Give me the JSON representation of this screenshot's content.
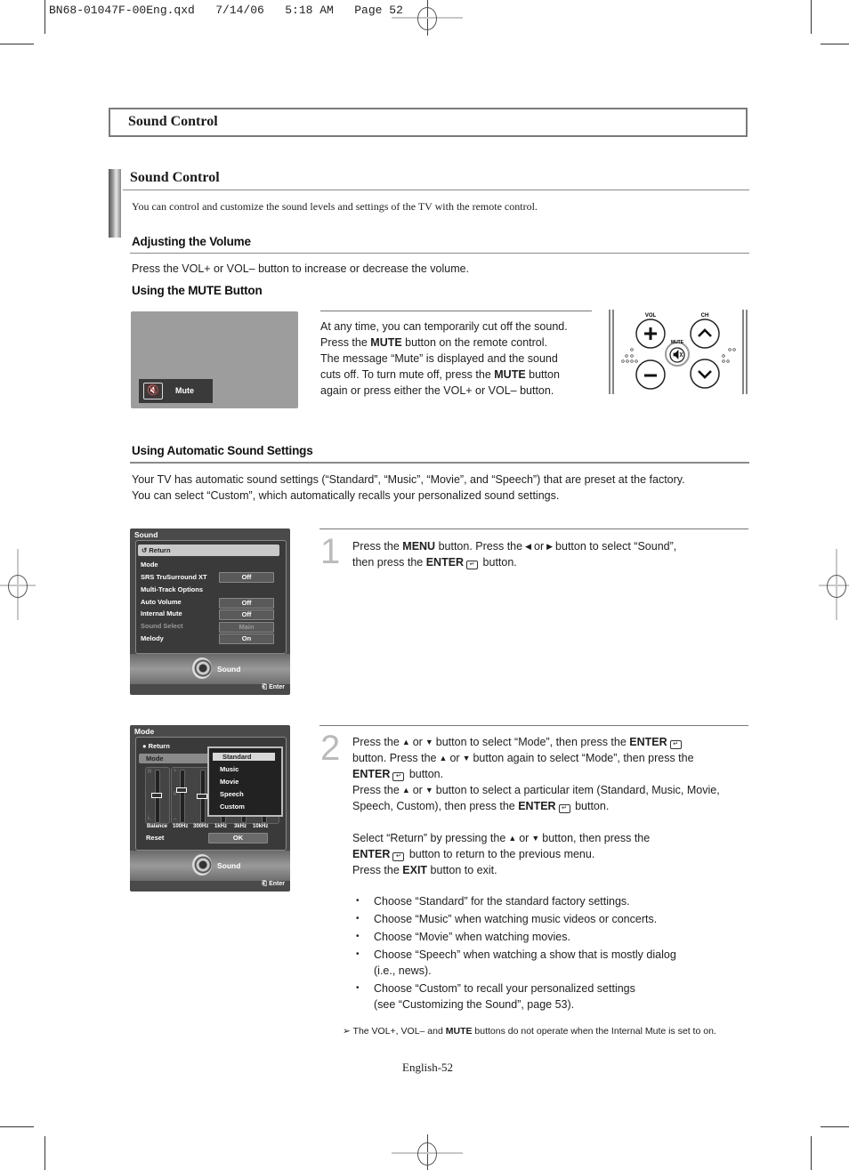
{
  "slug": "BN68-01047F-00Eng.qxd   7/14/06   5:18 AM   Page 52",
  "header_box": {
    "title": "Sound Control"
  },
  "section": {
    "title": "Sound Control",
    "intro": "You can control and customize the sound levels and settings of the TV with the remote control."
  },
  "volume": {
    "heading": "Adjusting the Volume",
    "text": "Press the VOL+ or VOL– button to increase or decrease the volume."
  },
  "mute": {
    "heading": "Using the MUTE Button",
    "screen_label": "Mute",
    "lines": [
      {
        "pre": "At any time, you can temporarily cut off the sound.",
        "bold": "",
        "post": ""
      },
      {
        "pre": "Press the ",
        "bold": "MUTE",
        "post": " button on the remote control."
      },
      {
        "pre": "The message “Mute” is displayed and the sound",
        "bold": "",
        "post": ""
      },
      {
        "pre": "cuts off. To turn mute off, press the ",
        "bold": "MUTE",
        "post": " button"
      },
      {
        "pre": "again or press either the VOL+ or VOL– button.",
        "bold": "",
        "post": ""
      }
    ],
    "remote": {
      "vol_label": "VOL",
      "ch_label": "CH",
      "mute_label": "MUTE"
    }
  },
  "auto": {
    "heading": "Using Automatic Sound Settings",
    "line1": "Your TV has automatic sound settings (“Standard”, “Music”, “Movie”, and “Speech”) that are preset at the factory.",
    "line2": "You can select “Custom”, which automatically recalls your personalized sound settings."
  },
  "menu1": {
    "title": "Sound",
    "return_label": "Return",
    "items": [
      {
        "label": "Mode",
        "value": null,
        "dim": false
      },
      {
        "label": "SRS TruSurround XT",
        "value": "Off",
        "dim": false
      },
      {
        "label": "Multi-Track Options",
        "value": null,
        "dim": false
      },
      {
        "label": "Auto Volume",
        "value": "Off",
        "dim": false
      },
      {
        "label": "Internal Mute",
        "value": "Off",
        "dim": false
      },
      {
        "label": "Sound Select",
        "value": "Main",
        "dim": true
      },
      {
        "label": "Melody",
        "value": "On",
        "dim": false
      }
    ],
    "footer_label": "Sound",
    "enter_label": "Enter"
  },
  "menu2": {
    "title": "Mode",
    "return_label": "Return",
    "mode_label": "Mode",
    "dropdown": [
      "Standard",
      "Music",
      "Movie",
      "Speech",
      "Custom"
    ],
    "dropdown_selected": "Standard",
    "eq_labels": [
      "Balance",
      "100Hz",
      "300Hz",
      "1kHz",
      "3kHz",
      "10kHz"
    ],
    "balance_marks": {
      "top": "R",
      "bottom": "L"
    },
    "eq_marks": {
      "top": "+",
      "mid": "0",
      "bottom": "–"
    },
    "reset_label": "Reset",
    "ok_label": "OK",
    "footer_label": "Sound",
    "enter_label": "Enter"
  },
  "step1": {
    "number": "1",
    "l1_a": "Press the ",
    "l1_b": "MENU",
    "l1_c": " button. Press the",
    "l1_or": "or",
    "l1_d": "button to select “Sound”,",
    "l2_a": "then press the ",
    "l2_b": "ENTER",
    "l2_c": " button."
  },
  "step2": {
    "number": "2",
    "p1_a": "Press the",
    "p1_or": "or",
    "p1_b": "button to select “Mode”, then press the ",
    "p1_enter": "ENTER",
    "p2_a": "button. Press the",
    "p2_or": "or",
    "p2_b": "button again to select “Mode”, then press the",
    "p3_enter": "ENTER",
    "p3_b": " button.",
    "p4_a": "Press the",
    "p4_or": "or",
    "p4_b": "button to select a particular item (Standard, Music, Movie,",
    "p5_a": "Speech, Custom), then press the ",
    "p5_enter": "ENTER",
    "p5_b": " button.",
    "p6_a": "Select “Return” by pressing the",
    "p6_or": "or",
    "p6_b": "button, then press the",
    "p7_enter": "ENTER",
    "p7_b": " button to return to the previous menu.",
    "p8_a": "Press the ",
    "p8_exit": "EXIT",
    "p8_b": " button to exit.",
    "bullets": [
      "Choose “Standard” for the standard factory settings.",
      "Choose “Music” when watching music videos or concerts.",
      "Choose “Movie” when watching movies.",
      "Choose “Speech” when watching a show that is mostly dialog\n(i.e., news).",
      "Choose “Custom” to recall your personalized settings\n(see “Customizing the Sound”, page 53)."
    ]
  },
  "note": {
    "a": "The VOL+, VOL– and ",
    "b": "MUTE",
    "c": " buttons do not  operate when the Internal Mute is set to on."
  },
  "footer": {
    "page": "English-52"
  }
}
